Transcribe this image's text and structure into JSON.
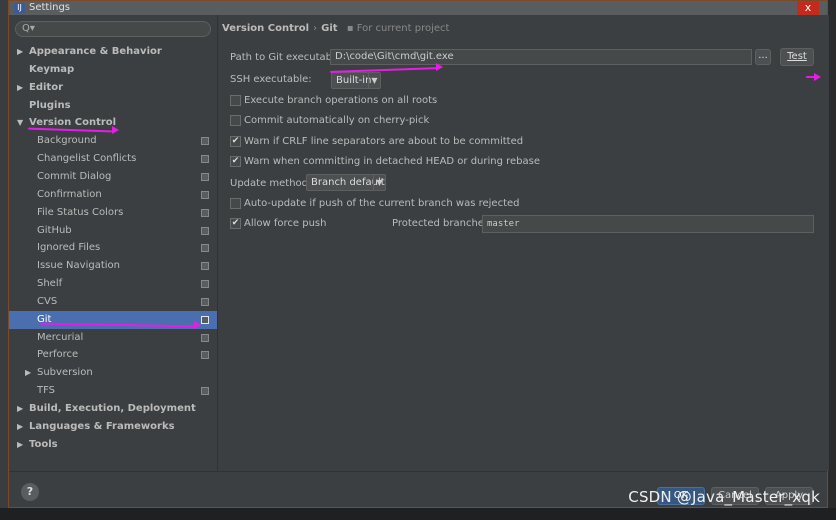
{
  "window": {
    "title": "Settings",
    "close_glyph": "x"
  },
  "search": {
    "placeholder": "Q▾"
  },
  "tree": {
    "items": [
      {
        "label": "Appearance & Behavior",
        "level": 0,
        "arrow": "▶"
      },
      {
        "label": "Keymap",
        "level": 0
      },
      {
        "label": "Editor",
        "level": 0,
        "arrow": "▶"
      },
      {
        "label": "Plugins",
        "level": 0
      },
      {
        "label": "Version Control",
        "level": 0,
        "arrow": "▼"
      },
      {
        "label": "Background",
        "level": 1
      },
      {
        "label": "Changelist Conflicts",
        "level": 1
      },
      {
        "label": "Commit Dialog",
        "level": 1
      },
      {
        "label": "Confirmation",
        "level": 1
      },
      {
        "label": "File Status Colors",
        "level": 1
      },
      {
        "label": "GitHub",
        "level": 1
      },
      {
        "label": "Ignored Files",
        "level": 1
      },
      {
        "label": "Issue Navigation",
        "level": 1
      },
      {
        "label": "Shelf",
        "level": 1
      },
      {
        "label": "CVS",
        "level": 1
      },
      {
        "label": "Git",
        "level": 1,
        "selected": true
      },
      {
        "label": "Mercurial",
        "level": 1
      },
      {
        "label": "Perforce",
        "level": 1
      },
      {
        "label": "Subversion",
        "level": 1,
        "arrow": "▶"
      },
      {
        "label": "TFS",
        "level": 1
      },
      {
        "label": "Build, Execution, Deployment",
        "level": 0,
        "arrow": "▶"
      },
      {
        "label": "Languages & Frameworks",
        "level": 0,
        "arrow": "▶"
      },
      {
        "label": "Tools",
        "level": 0,
        "arrow": "▶"
      }
    ]
  },
  "breadcrumb": {
    "parent": "Version Control",
    "separator": "›",
    "current": "Git",
    "scope": "For current project"
  },
  "git": {
    "path_label": "Path to Git executable:",
    "path_value": "D:\\code\\Git\\cmd\\git.exe",
    "browse_label": "...",
    "test_label": "Test",
    "ssh_label": "SSH executable:",
    "ssh_value": "Built-in",
    "options": [
      {
        "label": "Execute branch operations on all roots",
        "checked": false
      },
      {
        "label": "Commit automatically on cherry-pick",
        "checked": false
      },
      {
        "label": "Warn if CRLF line separators are about to be committed",
        "checked": true
      },
      {
        "label": "Warn when committing in detached HEAD or during rebase",
        "checked": true
      }
    ],
    "update_method_label": "Update method:",
    "update_method_value": "Branch default",
    "auto_update": {
      "label": "Auto-update if push of the current branch was rejected",
      "checked": false
    },
    "force_push": {
      "label": "Allow force push",
      "checked": true
    },
    "protected_label": "Protected branches:",
    "protected_value": "master",
    "check_glyph": "✔"
  },
  "help": {
    "glyph": "?"
  },
  "dialog_buttons": {
    "ok": "OK",
    "cancel": "Cancel",
    "apply": "Apply"
  },
  "watermark": "CSDN @Java_Master_xqk",
  "colors": {
    "annotation": "#e81ce8",
    "selection": "#4b6eaf"
  }
}
